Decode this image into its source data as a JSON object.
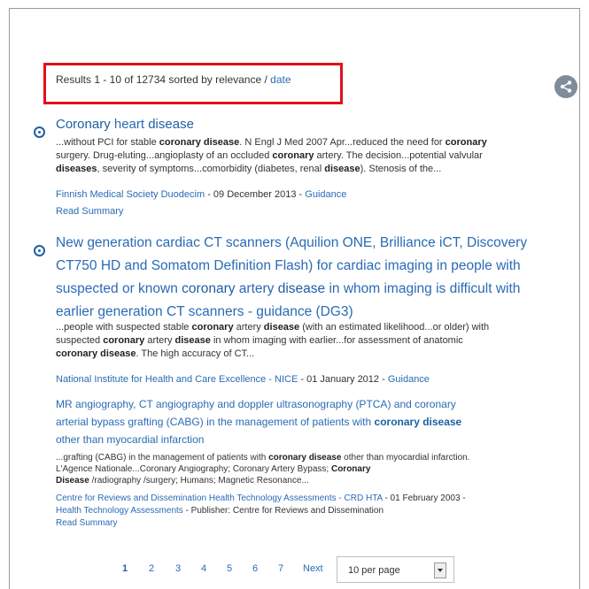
{
  "results_header": {
    "prefix": "Results 1 - 10 of 12734 sorted by relevance / ",
    "date_link": "date"
  },
  "results": [
    {
      "title": [
        "Coronary ",
        "heart ",
        "disease"
      ],
      "snippet_lines": [
        [
          "...without PCI for stable ",
          "coronary disease",
          ". N Engl J Med 2007 Apr...reduced the need for ",
          "coronary"
        ],
        [
          "surgery. Drug-eluting...angioplasty of an occluded ",
          "coronary",
          " artery. The decision...potential valvular"
        ],
        [
          "",
          "diseases",
          ", severity of symptoms...comorbidity (diabetes, renal ",
          "disease",
          "). Stenosis of the..."
        ]
      ],
      "source": "Finnish Medical Society Duodecim",
      "date": " - 09 December 2013 - ",
      "type": "Guidance",
      "read_summary": "Read Summary"
    },
    {
      "title_lines": [
        [
          "New generation cardiac CT scanners (Aquilion ONE, Brilliance iCT, Discovery"
        ],
        [
          "CT750 HD and Somatom Definition Flash) for cardiac imaging in people with"
        ],
        [
          "suspected or known ",
          "coronary",
          " artery ",
          "disease",
          " in whom imaging is difficult with"
        ],
        [
          "earlier generation CT scanners - guidance (DG3)"
        ]
      ],
      "snippet_lines": [
        [
          "...people with suspected stable ",
          "coronary",
          " artery ",
          "disease",
          " (with an estimated likelihood...or older) with"
        ],
        [
          "suspected ",
          "coronary",
          " artery ",
          "disease",
          " in whom imaging with earlier...for assessment of anatomic"
        ],
        [
          "",
          "coronary disease",
          ". The high accuracy of CT..."
        ]
      ],
      "source": "National Institute for Health and Care Excellence - NICE",
      "date": " - 01 January 2012 - ",
      "type": "Guidance"
    },
    {
      "title_lines": [
        [
          "MR angiography, CT angiography and doppler ultrasonography (PTCA) and coronary"
        ],
        [
          "arterial bypass grafting (CABG) in the management of patients with ",
          "coronary disease"
        ],
        [
          "other than myocardial infarction"
        ]
      ],
      "snippet_lines": [
        [
          "...grafting (CABG) in the management of patients with ",
          "coronary disease",
          " other than myocardial infarction."
        ],
        [
          "L'Agence Nationale...Coronary Angiography; Coronary Artery Bypass; ",
          "Coronary"
        ],
        [
          "",
          "Disease",
          " /radiography /surgery; Humans; Magnetic Resonance..."
        ]
      ],
      "source": "Centre for Reviews and Dissemination Health Technology Assessments - CRD HTA",
      "date": " - 01 February 2003 -",
      "source2": "Health Technology Assessments",
      "publisher": " - Publisher: Centre for Reviews and Dissemination",
      "read_summary": "Read Summary"
    }
  ],
  "pagination": {
    "pages": [
      "1",
      "2",
      "3",
      "4",
      "5",
      "6",
      "7"
    ],
    "active_page": "1",
    "next": "Next",
    "per_page": "10 per page"
  },
  "colors": {
    "accent": "#2a6bb5",
    "highlight_box": "#e0101c",
    "share_button": "#7f8c99"
  }
}
